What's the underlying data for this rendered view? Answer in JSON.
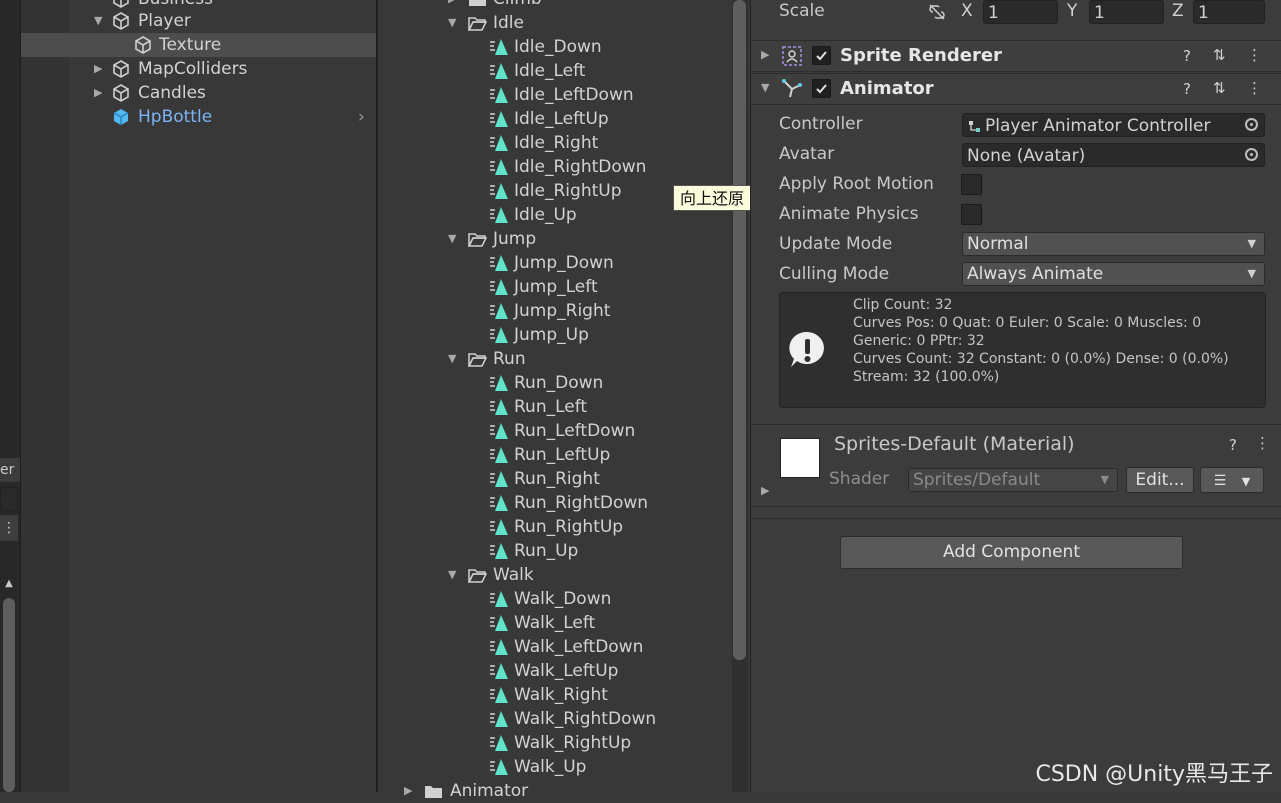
{
  "left_strip": {
    "tab_text": "er",
    "menu_glyph": "⋮"
  },
  "hierarchy": {
    "items": [
      {
        "label": "Business",
        "icon": "cube-icon"
      },
      {
        "label": "Player",
        "icon": "cube-icon"
      },
      {
        "label": "Texture",
        "icon": "cube-icon"
      },
      {
        "label": "MapColliders",
        "icon": "cube-icon"
      },
      {
        "label": "Candles",
        "icon": "cube-icon"
      },
      {
        "label": "HpBottle",
        "icon": "prefab-cube-icon"
      }
    ]
  },
  "project": {
    "folders": [
      {
        "label": "Climb",
        "clips": []
      },
      {
        "label": "Idle",
        "clips": [
          "Idle_Down",
          "Idle_Left",
          "Idle_LeftDown",
          "Idle_LeftUp",
          "Idle_Right",
          "Idle_RightDown",
          "Idle_RightUp",
          "Idle_Up"
        ]
      },
      {
        "label": "Jump",
        "clips": [
          "Jump_Down",
          "Jump_Left",
          "Jump_Right",
          "Jump_Up"
        ]
      },
      {
        "label": "Run",
        "clips": [
          "Run_Down",
          "Run_Left",
          "Run_LeftDown",
          "Run_LeftUp",
          "Run_Right",
          "Run_RightDown",
          "Run_RightUp",
          "Run_Up"
        ]
      },
      {
        "label": "Walk",
        "clips": [
          "Walk_Down",
          "Walk_Left",
          "Walk_LeftDown",
          "Walk_LeftUp",
          "Walk_Right",
          "Walk_RightDown",
          "Walk_RightUp",
          "Walk_Up"
        ]
      },
      {
        "label": "Animator",
        "clips": []
      }
    ]
  },
  "tooltip": "向上还原",
  "inspector": {
    "scale": {
      "label": "Scale",
      "x_label": "X",
      "x": "1",
      "y_label": "Y",
      "y": "1",
      "z_label": "Z",
      "z": "1"
    },
    "sprite_renderer": {
      "title": "Sprite Renderer",
      "enabled": true
    },
    "animator": {
      "title": "Animator",
      "enabled": true,
      "controller_label": "Controller",
      "controller_value": "Player Animator Controller",
      "avatar_label": "Avatar",
      "avatar_value": "None (Avatar)",
      "apply_root_motion_label": "Apply Root Motion",
      "apply_root_motion": false,
      "animate_physics_label": "Animate Physics",
      "animate_physics": false,
      "update_mode_label": "Update Mode",
      "update_mode": "Normal",
      "culling_mode_label": "Culling Mode",
      "culling_mode": "Always Animate",
      "info_lines": [
        "Clip Count: 32",
        "Curves Pos: 0 Quat: 0 Euler: 0 Scale: 0 Muscles: 0",
        "Generic: 0 PPtr: 32",
        "Curves Count: 32 Constant: 0 (0.0%) Dense: 0 (0.0%)",
        "Stream: 32 (100.0%)"
      ]
    },
    "material": {
      "title": "Sprites-Default (Material)",
      "shader_label": "Shader",
      "shader_value": "Sprites/Default",
      "edit_button": "Edit..."
    },
    "add_component": "Add Component"
  },
  "watermark": "CSDN @Unity黑马王子"
}
